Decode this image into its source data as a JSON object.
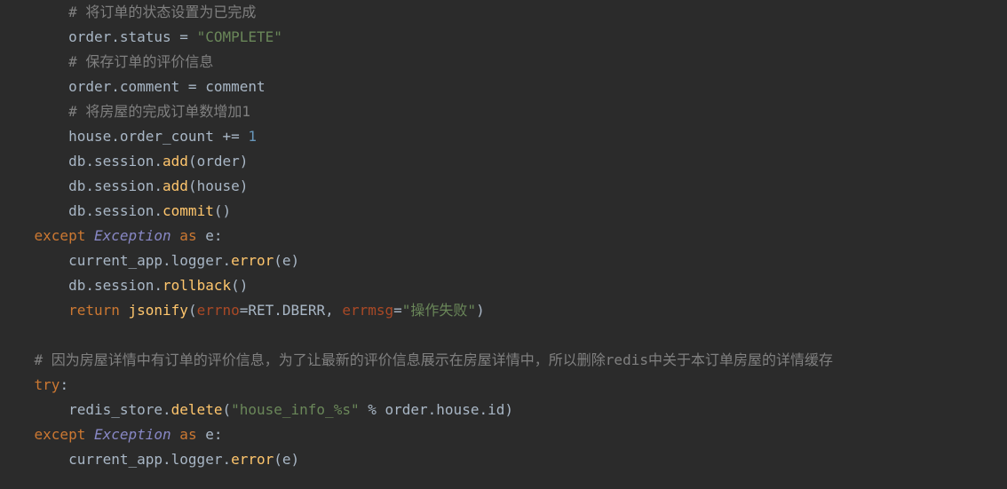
{
  "code": {
    "lines": [
      {
        "indent": "        ",
        "tokens": [
          {
            "cls": "comm",
            "t": "# 将订单的状态设置为已完成"
          }
        ]
      },
      {
        "indent": "        ",
        "tokens": [
          {
            "t": "order.status = "
          },
          {
            "cls": "str",
            "t": "\"COMPLETE\""
          }
        ]
      },
      {
        "indent": "        ",
        "tokens": [
          {
            "cls": "comm",
            "t": "# 保存订单的评价信息"
          }
        ]
      },
      {
        "indent": "        ",
        "tokens": [
          {
            "t": "order.comment = comment"
          }
        ]
      },
      {
        "indent": "        ",
        "tokens": [
          {
            "cls": "comm",
            "t": "# 将房屋的完成订单数增加1"
          }
        ]
      },
      {
        "indent": "        ",
        "tokens": [
          {
            "t": "house.order_count += "
          },
          {
            "cls": "num",
            "t": "1"
          }
        ]
      },
      {
        "indent": "        ",
        "tokens": [
          {
            "t": "db.session."
          },
          {
            "cls": "call",
            "t": "add"
          },
          {
            "t": "(order)"
          }
        ]
      },
      {
        "indent": "        ",
        "tokens": [
          {
            "t": "db.session."
          },
          {
            "cls": "call",
            "t": "add"
          },
          {
            "t": "(house)"
          }
        ]
      },
      {
        "indent": "        ",
        "tokens": [
          {
            "t": "db.session."
          },
          {
            "cls": "call",
            "t": "commit"
          },
          {
            "t": "()"
          }
        ]
      },
      {
        "indent": "    ",
        "tokens": [
          {
            "cls": "kw",
            "t": "except "
          },
          {
            "cls": "cls",
            "t": "Exception"
          },
          {
            "cls": "kw",
            "t": " as "
          },
          {
            "t": "e:"
          }
        ]
      },
      {
        "indent": "        ",
        "tokens": [
          {
            "t": "current_app.logger."
          },
          {
            "cls": "call",
            "t": "error"
          },
          {
            "t": "(e)"
          }
        ]
      },
      {
        "indent": "        ",
        "tokens": [
          {
            "t": "db.session."
          },
          {
            "cls": "call",
            "t": "rollback"
          },
          {
            "t": "()"
          }
        ]
      },
      {
        "indent": "        ",
        "tokens": [
          {
            "cls": "kw",
            "t": "return "
          },
          {
            "cls": "call",
            "t": "jsonify"
          },
          {
            "t": "("
          },
          {
            "cls": "param",
            "t": "errno"
          },
          {
            "t": "=RET.DBERR, "
          },
          {
            "cls": "param",
            "t": "errmsg"
          },
          {
            "t": "="
          },
          {
            "cls": "str",
            "t": "\"操作失败\""
          },
          {
            "t": ")"
          }
        ]
      },
      {
        "indent": "",
        "tokens": []
      },
      {
        "indent": "    ",
        "tokens": [
          {
            "cls": "comm",
            "t": "# 因为房屋详情中有订单的评价信息，为了让最新的评价信息展示在房屋详情中，所以删除redis中关于本订单房屋的详情缓存"
          }
        ]
      },
      {
        "indent": "    ",
        "tokens": [
          {
            "cls": "kw",
            "t": "try"
          },
          {
            "t": ":"
          }
        ]
      },
      {
        "indent": "        ",
        "tokens": [
          {
            "t": "redis_store."
          },
          {
            "cls": "call",
            "t": "delete"
          },
          {
            "t": "("
          },
          {
            "cls": "str",
            "t": "\"house_info_%s\""
          },
          {
            "t": " % order.house.id)"
          }
        ]
      },
      {
        "indent": "    ",
        "tokens": [
          {
            "cls": "kw",
            "t": "except "
          },
          {
            "cls": "cls",
            "t": "Exception"
          },
          {
            "cls": "kw",
            "t": " as "
          },
          {
            "t": "e:"
          }
        ]
      },
      {
        "indent": "        ",
        "tokens": [
          {
            "t": "current_app.logger."
          },
          {
            "cls": "call",
            "t": "error"
          },
          {
            "t": "(e)"
          }
        ]
      }
    ]
  }
}
